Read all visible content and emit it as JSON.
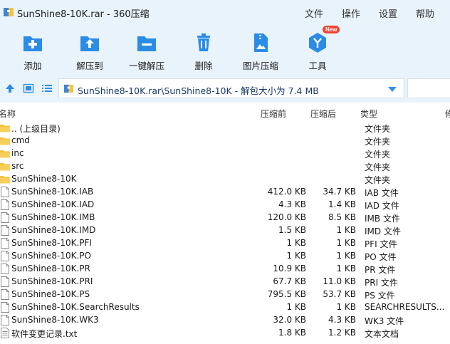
{
  "window": {
    "title": "SunShine8-10K.rar - 360压缩",
    "menu": [
      "文件",
      "操作",
      "设置",
      "帮助"
    ]
  },
  "toolbar": {
    "items": [
      {
        "label": "添加",
        "icon": "add-icon"
      },
      {
        "label": "解压到",
        "icon": "extract-to-icon"
      },
      {
        "label": "一键解压",
        "icon": "one-click-extract-icon"
      },
      {
        "label": "删除",
        "icon": "delete-icon"
      },
      {
        "label": "图片压缩",
        "icon": "image-compress-icon"
      },
      {
        "label": "工具",
        "icon": "tools-icon",
        "badge": "New"
      }
    ]
  },
  "address": {
    "path": "SunShine8-10K.rar\\SunShine8-10K - 解包大小为 7.4 MB"
  },
  "columns": {
    "name": "名称",
    "before": "压缩前",
    "after": "压缩后",
    "type": "类型",
    "extra": "修"
  },
  "files": [
    {
      "name": ".. (上级目录)",
      "before": "",
      "after": "",
      "type": "文件夹",
      "kind": "folder"
    },
    {
      "name": "cmd",
      "before": "",
      "after": "",
      "type": "文件夹",
      "kind": "folder"
    },
    {
      "name": "inc",
      "before": "",
      "after": "",
      "type": "文件夹",
      "kind": "folder"
    },
    {
      "name": "src",
      "before": "",
      "after": "",
      "type": "文件夹",
      "kind": "folder"
    },
    {
      "name": "SunShine8-10K",
      "before": "",
      "after": "",
      "type": "文件夹",
      "kind": "folder"
    },
    {
      "name": "SunShine8-10K.IAB",
      "before": "412.0 KB",
      "after": "34.7 KB",
      "type": "IAB 文件",
      "kind": "file"
    },
    {
      "name": "SunShine8-10K.IAD",
      "before": "4.3 KB",
      "after": "1.4 KB",
      "type": "IAD 文件",
      "kind": "file"
    },
    {
      "name": "SunShine8-10K.IMB",
      "before": "120.0 KB",
      "after": "8.5 KB",
      "type": "IMB 文件",
      "kind": "file"
    },
    {
      "name": "SunShine8-10K.IMD",
      "before": "1.5 KB",
      "after": "1 KB",
      "type": "IMD 文件",
      "kind": "file"
    },
    {
      "name": "SunShine8-10K.PFI",
      "before": "1 KB",
      "after": "1 KB",
      "type": "PFI 文件",
      "kind": "file"
    },
    {
      "name": "SunShine8-10K.PO",
      "before": "1 KB",
      "after": "1 KB",
      "type": "PO 文件",
      "kind": "file"
    },
    {
      "name": "SunShine8-10K.PR",
      "before": "10.9 KB",
      "after": "1 KB",
      "type": "PR 文件",
      "kind": "file"
    },
    {
      "name": "SunShine8-10K.PRI",
      "before": "67.7 KB",
      "after": "11.0 KB",
      "type": "PRI 文件",
      "kind": "file"
    },
    {
      "name": "SunShine8-10K.PS",
      "before": "795.5 KB",
      "after": "53.7 KB",
      "type": "PS 文件",
      "kind": "file"
    },
    {
      "name": "SunShine8-10K.SearchResults",
      "before": "1 KB",
      "after": "1 KB",
      "type": "SEARCHRESULTS...",
      "kind": "file"
    },
    {
      "name": "SunShine8-10K.WK3",
      "before": "32.0 KB",
      "after": "4.3 KB",
      "type": "WK3 文件",
      "kind": "file"
    },
    {
      "name": "软件变更记录.txt",
      "before": "1.8 KB",
      "after": "1.2 KB",
      "type": "文本文档",
      "kind": "text"
    }
  ],
  "colors": {
    "chrome_bg": "#e9f3fc",
    "accent": "#2b8ce6",
    "folder": "#f5c242",
    "badge": "#f0442f"
  }
}
